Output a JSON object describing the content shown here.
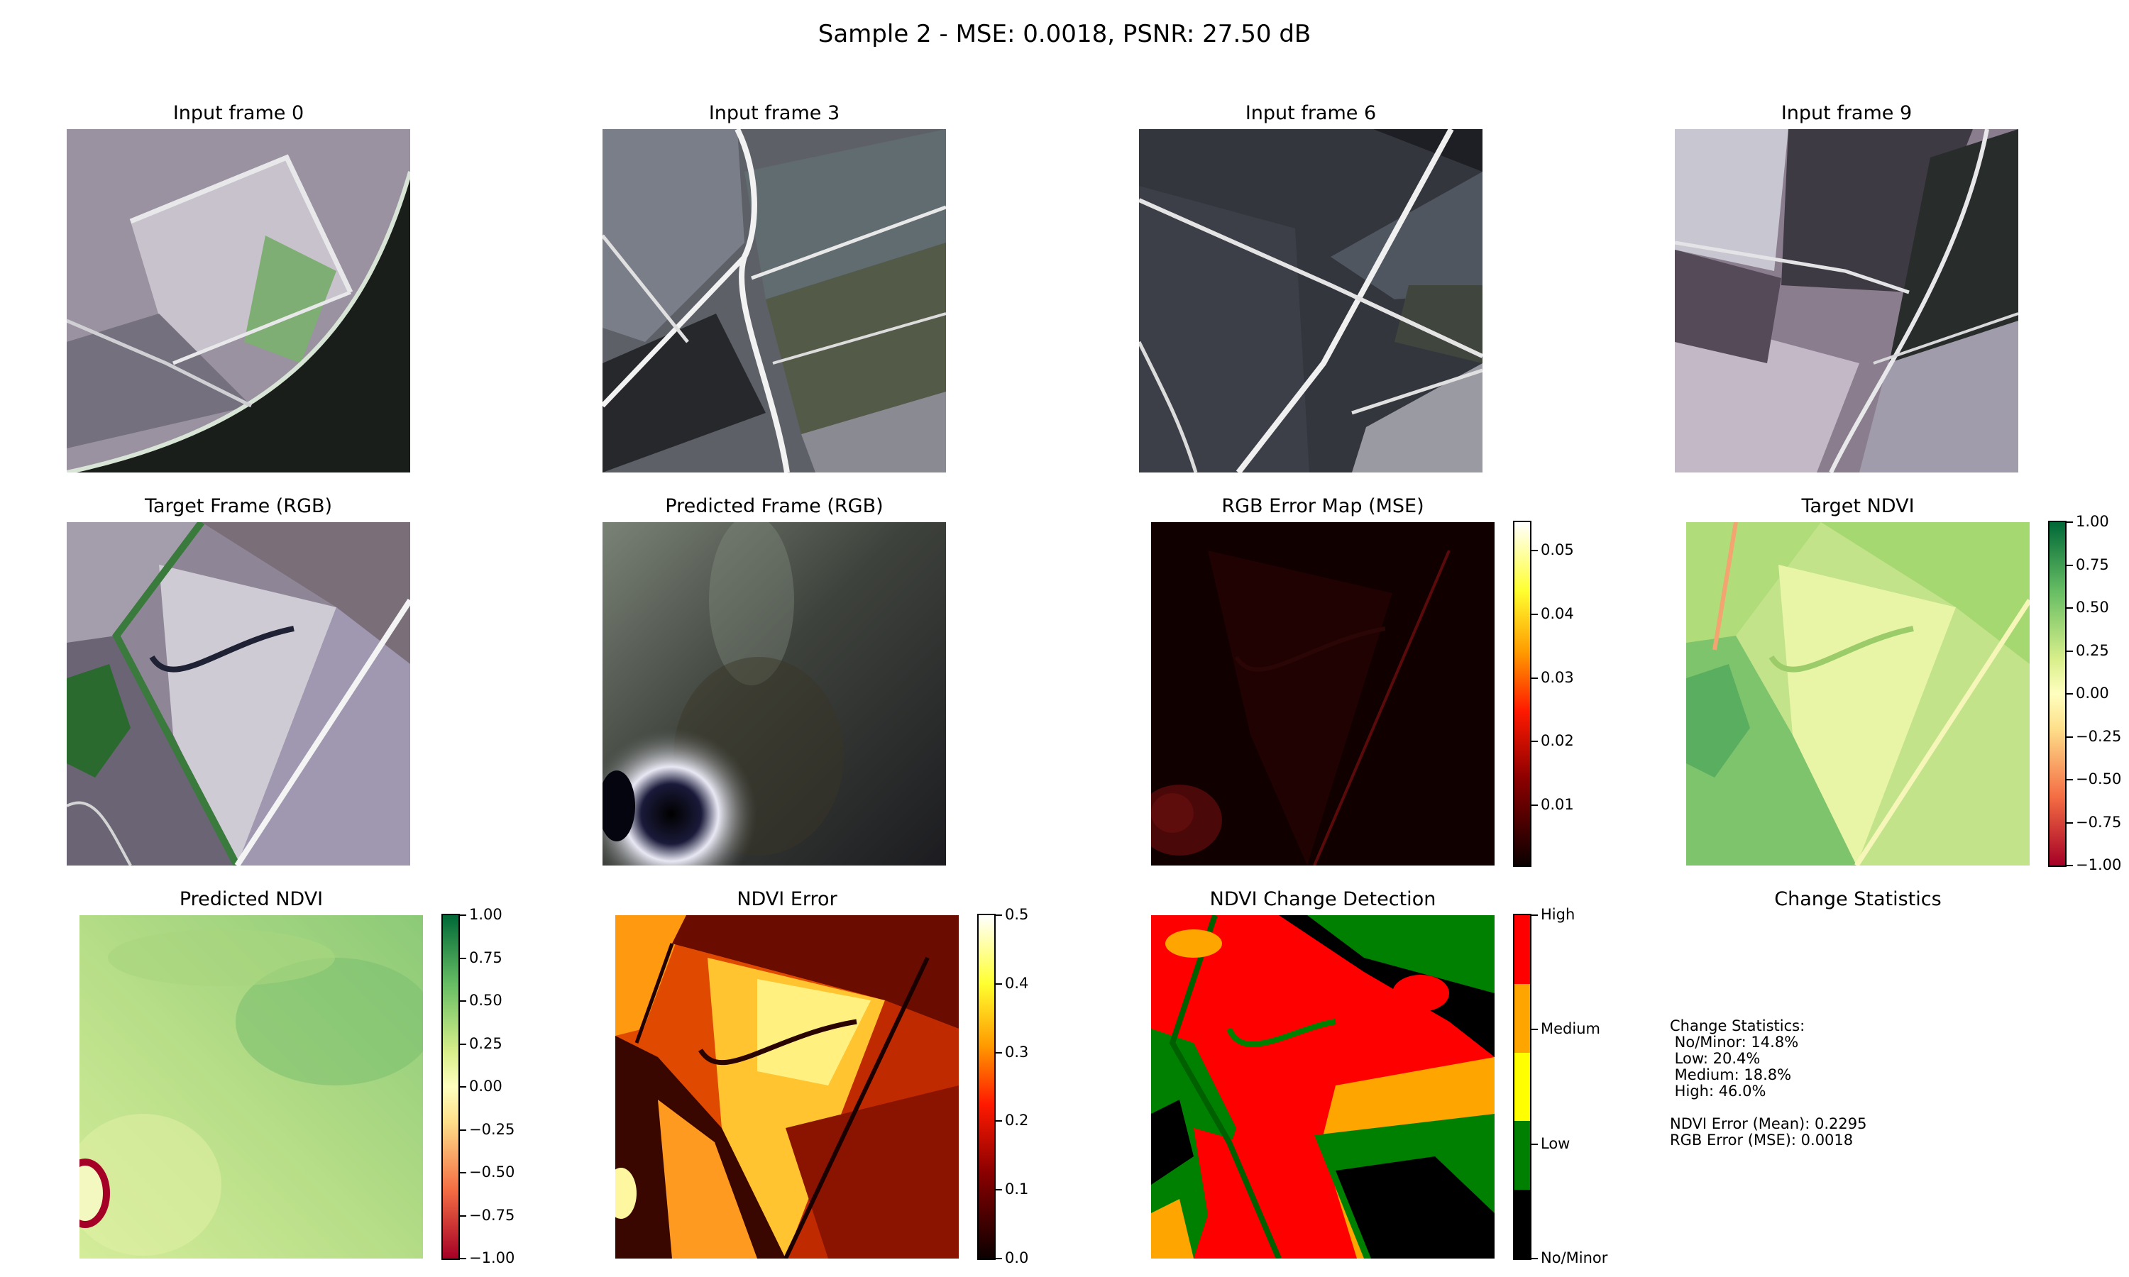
{
  "figure": {
    "suptitle": "Sample 2 - MSE: 0.0018, PSNR: 27.50 dB"
  },
  "panels": {
    "input0": "Input frame 0",
    "input3": "Input frame 3",
    "input6": "Input frame 6",
    "input9": "Input frame 9",
    "target_rgb": "Target Frame (RGB)",
    "pred_rgb": "Predicted Frame (RGB)",
    "rgb_err": "RGB Error Map (MSE)",
    "target_ndvi": "Target NDVI",
    "pred_ndvi": "Predicted NDVI",
    "ndvi_err": "NDVI Error",
    "change": "NDVI Change Detection",
    "stats_title": "Change Statistics"
  },
  "colorbars": {
    "rgb_err": {
      "ticks": [
        "0.05",
        "0.04",
        "0.03",
        "0.02",
        "0.01"
      ],
      "range": [
        0.0005,
        0.0545
      ],
      "tick_values": [
        0.05,
        0.04,
        0.03,
        0.02,
        0.01
      ],
      "colormap": "hot"
    },
    "target_ndvi": {
      "ticks": [
        "1.00",
        "0.75",
        "0.50",
        "0.25",
        "0.00",
        "−0.25",
        "−0.50",
        "−0.75",
        "−1.00"
      ],
      "range": [
        -1,
        1
      ],
      "colormap": "RdYlGn"
    },
    "pred_ndvi": {
      "ticks": [
        "1.00",
        "0.75",
        "0.50",
        "0.25",
        "0.00",
        "−0.25",
        "−0.50",
        "−0.75",
        "−1.00"
      ],
      "range": [
        -1,
        1
      ],
      "colormap": "RdYlGn"
    },
    "ndvi_err": {
      "ticks": [
        "0.5",
        "0.4",
        "0.3",
        "0.2",
        "0.1",
        "0.0"
      ],
      "range": [
        0,
        0.5
      ],
      "colormap": "hot"
    },
    "change": {
      "ticks": [
        "High",
        "Medium",
        "Low",
        "No/Minor"
      ],
      "colors": [
        "#ff0000",
        "#ffa500",
        "#ffff00",
        "#008000",
        "#000000"
      ]
    }
  },
  "stats": {
    "text": "Change Statistics:\n No/Minor: 14.8%\n Low: 20.4%\n Medium: 18.8%\n High: 46.0%\n\nNDVI Error (Mean): 0.2295\nRGB Error (MSE): 0.0018"
  },
  "chart_data": {
    "type": "heatmap",
    "title": "Sample 2 - MSE: 0.0018, PSNR: 27.50 dB",
    "mse": 0.0018,
    "psnr_db": 27.5,
    "change_statistics": [
      {
        "category": "No/Minor",
        "percent": 14.8
      },
      {
        "category": "Low",
        "percent": 20.4
      },
      {
        "category": "Medium",
        "percent": 18.8
      },
      {
        "category": "High",
        "percent": 46.0
      }
    ],
    "ndvi_error_mean": 0.2295,
    "rgb_error_mse": 0.0018
  }
}
